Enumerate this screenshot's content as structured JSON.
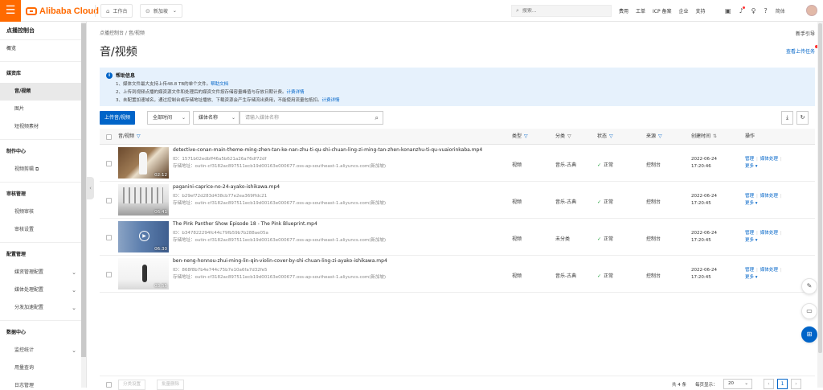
{
  "topbar": {
    "logo_text": "Alibaba Cloud",
    "workbench": "工作台",
    "region": "新加坡",
    "search_placeholder": "搜索...",
    "links": [
      "费用",
      "工单",
      "ICP 备案",
      "企业",
      "支持"
    ],
    "lang": "简体",
    "brand_color": "#ff6a00"
  },
  "sidebar": {
    "title": "点播控制台",
    "overview": "概览",
    "groups": [
      {
        "label": "媒资库",
        "items": [
          {
            "label": "音/视频",
            "active": true
          },
          {
            "label": "图片"
          },
          {
            "label": "短视频素材"
          }
        ]
      },
      {
        "label": "制作中心",
        "items": [
          {
            "label": "视频剪辑",
            "external": true
          }
        ]
      },
      {
        "label": "审核管理",
        "items": [
          {
            "label": "视频审核"
          },
          {
            "label": "审核设置"
          }
        ]
      },
      {
        "label": "配置管理",
        "items": [
          {
            "label": "媒资管理配置",
            "expandable": true
          },
          {
            "label": "媒体处理配置",
            "expandable": true
          },
          {
            "label": "分发加速配置",
            "expandable": true
          }
        ]
      },
      {
        "label": "数据中心",
        "items": [
          {
            "label": "监控统计",
            "expandable": true
          },
          {
            "label": "用量查询"
          },
          {
            "label": "日志管理"
          }
        ]
      }
    ]
  },
  "breadcrumb": [
    "点播控制台",
    "音/视频"
  ],
  "new_guide": "新手引导",
  "page_title": "音/视频",
  "upload_tasks": "查看上传任务",
  "help": {
    "title": "帮助信息",
    "lines": [
      {
        "text": "1、媒体文件最大支持上传48.8 TB的单个文件。",
        "link": "帮助文档"
      },
      {
        "text": "2、上传到视频点播的媒资源文件和处理后的媒资文件按存储容量峰值与存放日期计费。",
        "link": "计费详情"
      },
      {
        "text": "3、未配置加速域名，通过控制台或存储地址播放、下载资源会产生存储流出费用，不能使用流量包抵扣。",
        "link": "计费详情"
      }
    ]
  },
  "toolbar": {
    "upload_button": "上传音/视频",
    "time_filter": "全部时间",
    "field_select": "媒体名称",
    "search_placeholder": "请输入媒体名称"
  },
  "table": {
    "headers": {
      "name": "音/视频",
      "type": "类型",
      "category": "分类",
      "status": "状态",
      "source": "来源",
      "created": "创建时间",
      "actions": "操作"
    },
    "rows": [
      {
        "title": "detective-conan-main-theme-ming-zhen-tan-ke-nan-zhu-ti-qu-shi-chuan-ling-zi-ming-tan-zhen-konanzhu-ti-qu-vuaiorinkaba.mp4",
        "id": "ID：1571b02edbff46a5b621a26a76df72df",
        "address": "存储地址：outin-cf3182ac897511ecb19d00163e000677.oss-ap-southeast-1.aliyuncs.com(新加坡)",
        "duration": "02:12",
        "type": "视频",
        "category": "音乐-古典",
        "status": "正常",
        "source": "控制台",
        "date": "2022-06-24",
        "time": "17:20:46"
      },
      {
        "title": "paganini-caprice-no-24-ayako-ishikawa.mp4",
        "id": "ID：b29ef72d283d438cb77e2ea369ffdc21",
        "address": "存储地址：outin-cf3182ac897511ecb19d00163e000677.oss-ap-southeast-1.aliyuncs.com(新加坡)",
        "duration": "06:41",
        "type": "视频",
        "category": "音乐-古典",
        "status": "正常",
        "source": "控制台",
        "date": "2022-06-24",
        "time": "17:20:45"
      },
      {
        "title": "The Pink Panther Show Episode 18 - The Pink Blueprint.mp4",
        "id": "ID：b347822294fc44c79fb59b7b288ae05a",
        "address": "存储地址：outin-cf3182ac897511ecb19d00163e000677.oss-ap-southeast-1.aliyuncs.com(新加坡)",
        "duration": "06:30",
        "type": "视频",
        "category": "未分类",
        "status": "正常",
        "source": "控制台",
        "date": "2022-06-24",
        "time": "17:20:45"
      },
      {
        "title": "ben-neng-honnou-zhui-ming-lin-qin-violin-cover-by-shi-chuan-ling-zi-ayako-ishikawa.mp4",
        "id": "ID：868f8b7b4e744c75b7e10a6fa7d32fe5",
        "address": "存储地址：outin-cf3182ac897511ecb19d00163e000677.oss-ap-southeast-1.aliyuncs.com(新加坡)",
        "duration": "03:55",
        "type": "视频",
        "category": "音乐-古典",
        "status": "正常",
        "source": "控制台",
        "date": "2022-06-24",
        "time": "17:20:45"
      }
    ],
    "action_manage": "管理",
    "action_process": "媒体处理",
    "action_more": "更多"
  },
  "footer": {
    "btn_category": "分类设置",
    "btn_delete": "批量删除",
    "total": "共 4 条",
    "per_page_label": "每页显示：",
    "per_page": "20",
    "page": "1"
  }
}
